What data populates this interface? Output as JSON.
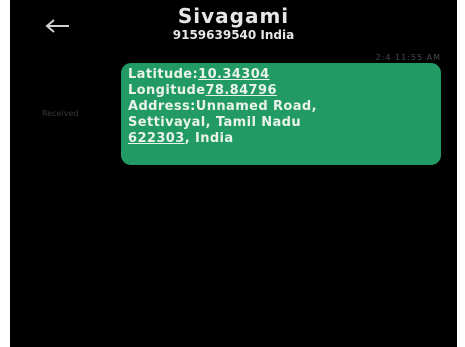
{
  "header": {
    "back_icon": "arrow-left-icon",
    "contact_name": "Sivagami",
    "contact_number_line": "9159639540 India"
  },
  "message": {
    "timestamp": "2:4 11:55 AM",
    "status_label": "Received",
    "latitude_label": "Latitude:",
    "latitude_value": "10.34304",
    "longitude_label": "Longitude",
    "longitude_value": "78.84796",
    "address_line1": "Address:Unnamed Road,",
    "address_line2": "Settivayal, Tamil Nadu",
    "postal_code": "622303",
    "country_suffix": ", India"
  },
  "colors": {
    "background": "#000000",
    "bubble": "#229a63",
    "text": "#e6e6e6"
  }
}
